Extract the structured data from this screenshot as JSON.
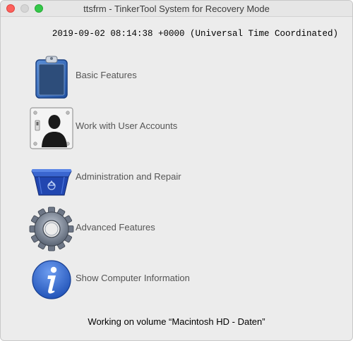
{
  "window": {
    "title": "ttsfrm - TinkerTool System for Recovery Mode"
  },
  "datetime": "2019-09-02 08:14:38 +0000 (Universal Time Coordinated)",
  "menu": [
    {
      "label": "Basic Features",
      "icon": "clipboard-icon"
    },
    {
      "label": "Work with User Accounts",
      "icon": "user-silhouette-icon"
    },
    {
      "label": "Administration and Repair",
      "icon": "recycle-bin-icon"
    },
    {
      "label": "Advanced Features",
      "icon": "gear-icon"
    },
    {
      "label": "Show Computer Information",
      "icon": "info-icon"
    }
  ],
  "status": "Working on volume “Macintosh HD - Daten”",
  "colors": {
    "close": "#fc605c",
    "minimize": "#d5d5d5",
    "maximize": "#34c84a",
    "window_bg": "#ececec"
  }
}
